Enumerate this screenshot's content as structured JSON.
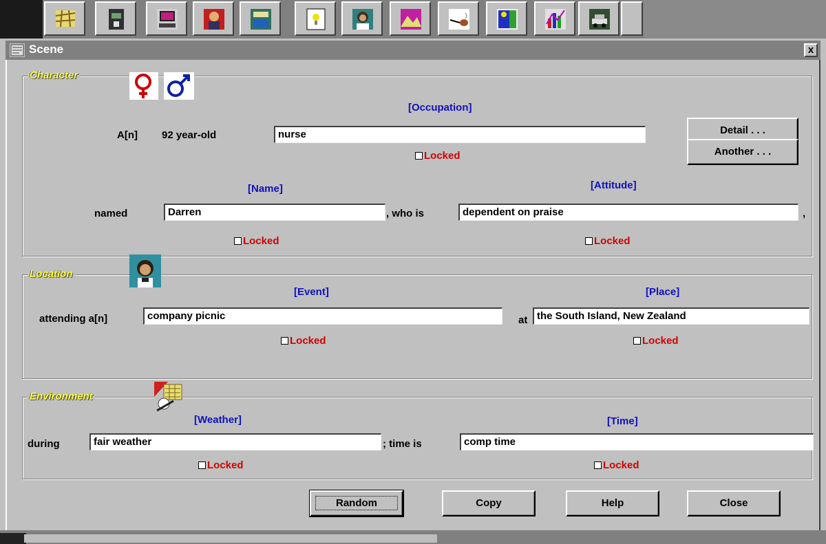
{
  "toolbar": {
    "icons": [
      "map-icon",
      "phone-icon",
      "computer-icon",
      "person-portrait-icon",
      "calculator-icon",
      "lightbulb-icon",
      "portrait-icon",
      "mountain-icon",
      "pipe-icon",
      "figure-icon",
      "chart-icon",
      "car-icon"
    ]
  },
  "window": {
    "title": "Scene",
    "close_glyph": "x"
  },
  "character": {
    "legend": "Character",
    "occupation_header": "[Occupation]",
    "article": "A[n]",
    "age_text": "92 year-old",
    "occupation_value": "nurse",
    "occupation_locked_label": "Locked",
    "name_header": "[Name]",
    "named_label": "named",
    "name_value": "Darren",
    "who_is_label": ", who is",
    "attitude_header": "[Attitude]",
    "attitude_value": "dependent on praise",
    "name_locked_label": "Locked",
    "attitude_locked_label": "Locked",
    "detail_button": "Detail . . .",
    "another_button": "Another . . ."
  },
  "location": {
    "legend": "Location",
    "event_header": "[Event]",
    "attending_label": "attending a[n]",
    "event_value": "company picnic",
    "at_label": "at",
    "place_header": "[Place]",
    "place_value": "the South Island, New Zealand",
    "event_locked_label": "Locked",
    "place_locked_label": "Locked"
  },
  "environment": {
    "legend": "Environment",
    "weather_header": "[Weather]",
    "during_label": "during",
    "weather_value": "fair weather",
    "time_is_label": "; time is",
    "time_header": "[Time]",
    "time_value": "comp time",
    "weather_locked_label": "Locked",
    "time_locked_label": "Locked"
  },
  "buttons": {
    "random": "Random",
    "copy": "Copy",
    "help": "Help",
    "close": "Close"
  },
  "colors": {
    "header_blue": "#1010c0",
    "locked_red": "#d00000",
    "legend_yellow": "#ffff40",
    "female_symbol": "#cc0000",
    "male_symbol": "#1020a0"
  }
}
